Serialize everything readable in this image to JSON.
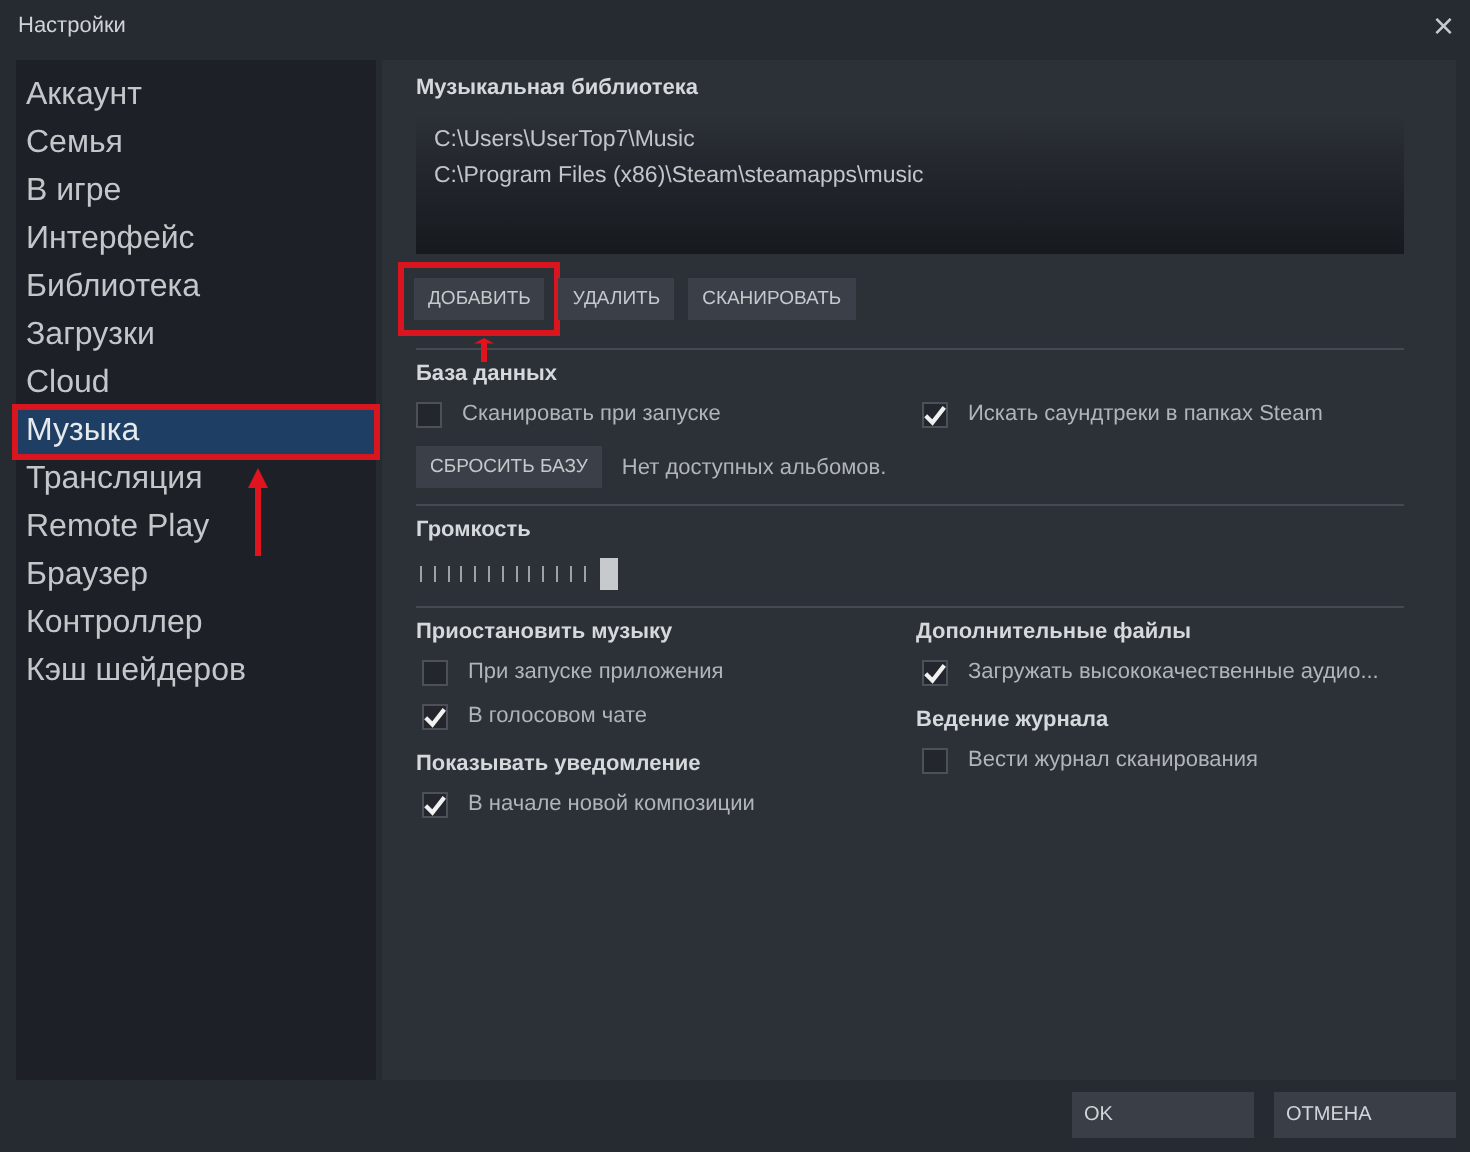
{
  "window": {
    "title": "Настройки",
    "close": "×"
  },
  "sidebar": {
    "items": [
      {
        "label": "Аккаунт",
        "selected": false,
        "highlighted": false
      },
      {
        "label": "Семья",
        "selected": false,
        "highlighted": false
      },
      {
        "label": "В игре",
        "selected": false,
        "highlighted": false
      },
      {
        "label": "Интерфейс",
        "selected": false,
        "highlighted": false
      },
      {
        "label": "Библиотека",
        "selected": false,
        "highlighted": false
      },
      {
        "label": "Загрузки",
        "selected": false,
        "highlighted": false
      },
      {
        "label": "Cloud",
        "selected": false,
        "highlighted": false
      },
      {
        "label": "Музыка",
        "selected": true,
        "highlighted": true
      },
      {
        "label": "Трансляция",
        "selected": false,
        "highlighted": false
      },
      {
        "label": "Remote Play",
        "selected": false,
        "highlighted": false
      },
      {
        "label": "Браузер",
        "selected": false,
        "highlighted": false
      },
      {
        "label": "Контроллер",
        "selected": false,
        "highlighted": false
      },
      {
        "label": "Кэш шейдеров",
        "selected": false,
        "highlighted": false
      }
    ]
  },
  "library": {
    "title": "Музыкальная библиотека",
    "folders": [
      "C:\\Users\\UserTop7\\Music",
      "C:\\Program Files (x86)\\Steam\\steamapps\\music"
    ],
    "buttons": [
      {
        "label": "ДОБАВИТЬ",
        "highlighted": true
      },
      {
        "label": "УДАЛИТЬ",
        "highlighted": false
      },
      {
        "label": "СКАНИРОВАТЬ",
        "highlighted": false
      }
    ]
  },
  "database": {
    "title": "База данных",
    "options": [
      {
        "label": "Сканировать при запуске",
        "checked": false
      },
      {
        "label": "Искать саундтреки в папках Steam",
        "checked": true
      }
    ],
    "reset_button": "СБРОСИТЬ БАЗУ",
    "status": "Нет доступных альбомов."
  },
  "volume": {
    "title": "Громкость",
    "level": 0.4
  },
  "columns": [
    {
      "groups": [
        {
          "title": "Приостановить музыку",
          "options": [
            {
              "label": "При запуске приложения",
              "checked": false
            },
            {
              "label": "В голосовом чате",
              "checked": true
            }
          ]
        },
        {
          "title": "Показывать уведомление",
          "options": [
            {
              "label": "В начале новой композиции",
              "checked": true
            }
          ]
        }
      ]
    },
    {
      "groups": [
        {
          "title": "Дополнительные файлы",
          "options": [
            {
              "label": "Загружать высококачественные аудио...",
              "checked": true
            }
          ]
        },
        {
          "title": "Ведение журнала",
          "options": [
            {
              "label": "Вести журнал сканирования",
              "checked": false
            }
          ]
        }
      ]
    }
  ],
  "footer": {
    "buttons": [
      "OK",
      "ОТМЕНА"
    ]
  }
}
